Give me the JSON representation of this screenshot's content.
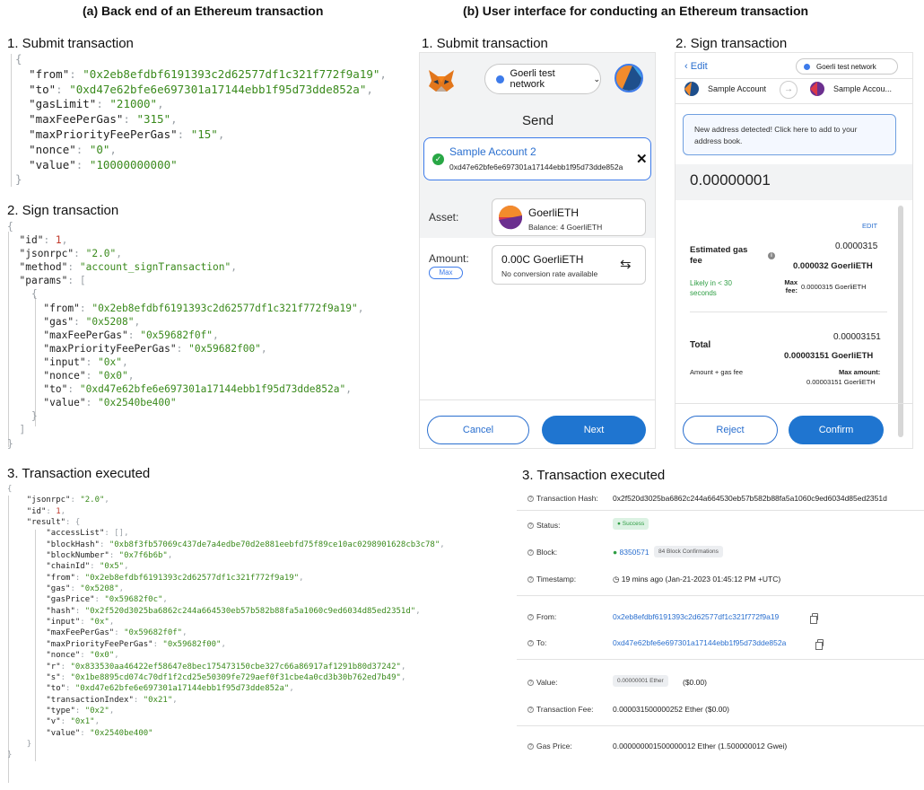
{
  "captions": {
    "a": "(a) Back end of an Ethereum transaction",
    "b": "(b) User interface for conducting an Ethereum transaction"
  },
  "backend": {
    "submit": {
      "title": "1. Submit transaction",
      "lines": [
        {
          "pre": "{",
          "k": "",
          "v": "",
          "post": "",
          "indent": 0
        },
        {
          "pre": "",
          "k": "\"from\"",
          "v": "\"0x2eb8efdbf6191393c2d62577df1c321f772f9a19\"",
          "post": ",",
          "indent": 1
        },
        {
          "pre": "",
          "k": "\"to\"",
          "v": "\"0xd47e62bfe6e697301a17144ebb1f95d73dde852a\"",
          "post": ",",
          "indent": 1
        },
        {
          "pre": "",
          "k": "\"gasLimit\"",
          "v": "\"21000\"",
          "post": ",",
          "indent": 1
        },
        {
          "pre": "",
          "k": "\"maxFeePerGas\"",
          "v": "\"315\"",
          "post": ",",
          "indent": 1
        },
        {
          "pre": "",
          "k": "\"maxPriorityFeePerGas\"",
          "v": "\"15\"",
          "post": ",",
          "indent": 1
        },
        {
          "pre": "",
          "k": "\"nonce\"",
          "v": "\"0\"",
          "post": ",",
          "indent": 1
        },
        {
          "pre": "",
          "k": "\"value\"",
          "v": "\"10000000000\"",
          "post": "",
          "indent": 1
        },
        {
          "pre": "}",
          "k": "",
          "v": "",
          "post": "",
          "indent": 0
        }
      ]
    },
    "sign": {
      "title": "2. Sign transaction",
      "lines": [
        {
          "pre": "{",
          "k": "",
          "v": "",
          "post": "",
          "indent": 0,
          "num": false
        },
        {
          "pre": "",
          "k": "\"id\"",
          "v": "1",
          "post": ",",
          "indent": 1,
          "num": true
        },
        {
          "pre": "",
          "k": "\"jsonrpc\"",
          "v": "\"2.0\"",
          "post": ",",
          "indent": 1,
          "num": false
        },
        {
          "pre": "",
          "k": "\"method\"",
          "v": "\"account_signTransaction\"",
          "post": ",",
          "indent": 1,
          "num": false
        },
        {
          "pre": "",
          "k": "\"params\"",
          "v": "",
          "post": "[",
          "indent": 1,
          "num": false
        },
        {
          "pre": "{",
          "k": "",
          "v": "",
          "post": "",
          "indent": 2,
          "num": false
        },
        {
          "pre": "",
          "k": "\"from\"",
          "v": "\"0x2eb8efdbf6191393c2d62577df1c321f772f9a19\"",
          "post": ",",
          "indent": 3,
          "num": false
        },
        {
          "pre": "",
          "k": "\"gas\"",
          "v": "\"0x5208\"",
          "post": ",",
          "indent": 3,
          "num": false
        },
        {
          "pre": "",
          "k": "\"maxFeePerGas\"",
          "v": "\"0x59682f0f\"",
          "post": ",",
          "indent": 3,
          "num": false
        },
        {
          "pre": "",
          "k": "\"maxPriorityFeePerGas\"",
          "v": "\"0x59682f00\"",
          "post": ",",
          "indent": 3,
          "num": false
        },
        {
          "pre": "",
          "k": "\"input\"",
          "v": "\"0x\"",
          "post": ",",
          "indent": 3,
          "num": false
        },
        {
          "pre": "",
          "k": "\"nonce\"",
          "v": "\"0x0\"",
          "post": ",",
          "indent": 3,
          "num": false
        },
        {
          "pre": "",
          "k": "\"to\"",
          "v": "\"0xd47e62bfe6e697301a17144ebb1f95d73dde852a\"",
          "post": ",",
          "indent": 3,
          "num": false
        },
        {
          "pre": "",
          "k": "\"value\"",
          "v": "\"0x2540be400\"",
          "post": "",
          "indent": 3,
          "num": false
        },
        {
          "pre": "}",
          "k": "",
          "v": "",
          "post": "",
          "indent": 2,
          "num": false
        },
        {
          "pre": "]",
          "k": "",
          "v": "",
          "post": "",
          "indent": 1,
          "num": false
        },
        {
          "pre": "}",
          "k": "",
          "v": "",
          "post": "",
          "indent": 0,
          "num": false
        }
      ]
    },
    "executed": {
      "title": "3. Transaction executed",
      "lines": [
        {
          "pre": "{",
          "k": "",
          "v": "",
          "post": "",
          "indent": 0,
          "num": false
        },
        {
          "pre": "",
          "k": "\"jsonrpc\"",
          "v": "\"2.0\"",
          "post": ",",
          "indent": 1,
          "num": false
        },
        {
          "pre": "",
          "k": "\"id\"",
          "v": "1",
          "post": ",",
          "indent": 1,
          "num": true
        },
        {
          "pre": "",
          "k": "\"result\"",
          "v": "",
          "post": "{",
          "indent": 1,
          "num": false
        },
        {
          "pre": "",
          "k": "\"accessList\"",
          "v": "[]",
          "post": ",",
          "indent": 2,
          "num": false,
          "punct": true
        },
        {
          "pre": "",
          "k": "\"blockHash\"",
          "v": "\"0xb8f3fb57069c437de7a4edbe70d2e881eebfd75f89ce10ac0298901628cb3c78\"",
          "post": ",",
          "indent": 2,
          "num": false
        },
        {
          "pre": "",
          "k": "\"blockNumber\"",
          "v": "\"0x7f6b6b\"",
          "post": ",",
          "indent": 2,
          "num": false
        },
        {
          "pre": "",
          "k": "\"chainId\"",
          "v": "\"0x5\"",
          "post": ",",
          "indent": 2,
          "num": false
        },
        {
          "pre": "",
          "k": "\"from\"",
          "v": "\"0x2eb8efdbf6191393c2d62577df1c321f772f9a19\"",
          "post": ",",
          "indent": 2,
          "num": false
        },
        {
          "pre": "",
          "k": "\"gas\"",
          "v": "\"0x5208\"",
          "post": ",",
          "indent": 2,
          "num": false
        },
        {
          "pre": "",
          "k": "\"gasPrice\"",
          "v": "\"0x59682f0c\"",
          "post": ",",
          "indent": 2,
          "num": false
        },
        {
          "pre": "",
          "k": "\"hash\"",
          "v": "\"0x2f520d3025ba6862c244a664530eb57b582b88fa5a1060c9ed6034d85ed2351d\"",
          "post": ",",
          "indent": 2,
          "num": false
        },
        {
          "pre": "",
          "k": "\"input\"",
          "v": "\"0x\"",
          "post": ",",
          "indent": 2,
          "num": false
        },
        {
          "pre": "",
          "k": "\"maxFeePerGas\"",
          "v": "\"0x59682f0f\"",
          "post": ",",
          "indent": 2,
          "num": false
        },
        {
          "pre": "",
          "k": "\"maxPriorityFeePerGas\"",
          "v": "\"0x59682f00\"",
          "post": ",",
          "indent": 2,
          "num": false
        },
        {
          "pre": "",
          "k": "\"nonce\"",
          "v": "\"0x0\"",
          "post": ",",
          "indent": 2,
          "num": false
        },
        {
          "pre": "",
          "k": "\"r\"",
          "v": "\"0x833530aa46422ef58647e8bec175473150cbe327c66a86917af1291b80d37242\"",
          "post": ",",
          "indent": 2,
          "num": false
        },
        {
          "pre": "",
          "k": "\"s\"",
          "v": "\"0x1be8895cd074c70df1f2cd25e50309fe729aef0f31cbe4a0cd3b30b762ed7b49\"",
          "post": ",",
          "indent": 2,
          "num": false
        },
        {
          "pre": "",
          "k": "\"to\"",
          "v": "\"0xd47e62bfe6e697301a17144ebb1f95d73dde852a\"",
          "post": ",",
          "indent": 2,
          "num": false
        },
        {
          "pre": "",
          "k": "\"transactionIndex\"",
          "v": "\"0x21\"",
          "post": ",",
          "indent": 2,
          "num": false
        },
        {
          "pre": "",
          "k": "\"type\"",
          "v": "\"0x2\"",
          "post": ",",
          "indent": 2,
          "num": false
        },
        {
          "pre": "",
          "k": "\"v\"",
          "v": "\"0x1\"",
          "post": ",",
          "indent": 2,
          "num": false
        },
        {
          "pre": "",
          "k": "\"value\"",
          "v": "\"0x2540be400\"",
          "post": "",
          "indent": 2,
          "num": false
        },
        {
          "pre": "}",
          "k": "",
          "v": "",
          "post": "",
          "indent": 1,
          "num": false
        },
        {
          "pre": "}",
          "k": "",
          "v": "",
          "post": "",
          "indent": 0,
          "num": false
        }
      ]
    }
  },
  "submit_ui": {
    "title": "1. Submit transaction",
    "network": "Goerli test network",
    "heading": "Send",
    "recipient_name": "Sample Account 2",
    "recipient_address": "0xd47e62bfe6e697301a17144ebb1f95d73dde852a",
    "asset_label": "Asset:",
    "asset_name": "GoerliETH",
    "asset_balance": "Balance:  4 GoerliETH",
    "amount_label": "Amount:",
    "max_label": "Max",
    "amount_value": "0.00C GoerliETH",
    "amount_note": "No conversion rate available",
    "cancel_label": "Cancel",
    "next_label": "Next"
  },
  "sign_ui": {
    "title": "2. Sign transaction",
    "back_label": "Edit",
    "network": "Goerli test network",
    "from_account": "Sample Account",
    "to_account": "Sample Accou...",
    "notice": "New address detected! Click here to add to your address book.",
    "amount": "0.00000001",
    "edit_label": "EDIT",
    "gas_label": "Estimated gas fee",
    "gas_value": "0.0000315",
    "gas_value_bold": "0.000032 GoerliETH",
    "likely_label": "Likely in < 30 seconds",
    "max_fee_label": "Max fee:",
    "max_fee_value": "0.0000315 GoerliETH",
    "total_label": "Total",
    "total_value": "0.00003151",
    "total_value_bold": "0.00003151 GoerliETH",
    "amount_gas_label": "Amount + gas fee",
    "max_amount_label": "Max amount:",
    "max_amount_value": "0.00003151 GoerliETH",
    "reject_label": "Reject",
    "confirm_label": "Confirm"
  },
  "explorer": {
    "title": "3. Transaction executed",
    "rows": {
      "hash_label": "Transaction Hash:",
      "hash_value": "0x2f520d3025ba6862c244a664530eb57b582b88fa5a1060c9ed6034d85ed2351d",
      "status_label": "Status:",
      "status_value": "Success",
      "block_label": "Block:",
      "block_value": "8350571",
      "block_conf": "84 Block Confirmations",
      "time_label": "Timestamp:",
      "time_value": "19 mins ago (Jan-21-2023 01:45:12 PM +UTC)",
      "from_label": "From:",
      "from_value": "0x2eb8efdbf6191393c2d62577df1c321f772f9a19",
      "to_label": "To:",
      "to_value": "0xd47e62bfe6e697301a17144ebb1f95d73dde852a",
      "value_label": "Value:",
      "value_badge": "0.00000001 Ether",
      "value_usd": "($0.00)",
      "fee_label": "Transaction Fee:",
      "fee_value": "0.000031500000252 Ether ($0.00)",
      "gasprice_label": "Gas Price:",
      "gasprice_value": "0.000000001500000012 Ether (1.500000012 Gwei)"
    }
  },
  "colors": {
    "json_string": "#3a8a1c",
    "json_number": "#c0392b",
    "accent_blue": "#1f75d0",
    "success_green": "#2f9e44"
  }
}
